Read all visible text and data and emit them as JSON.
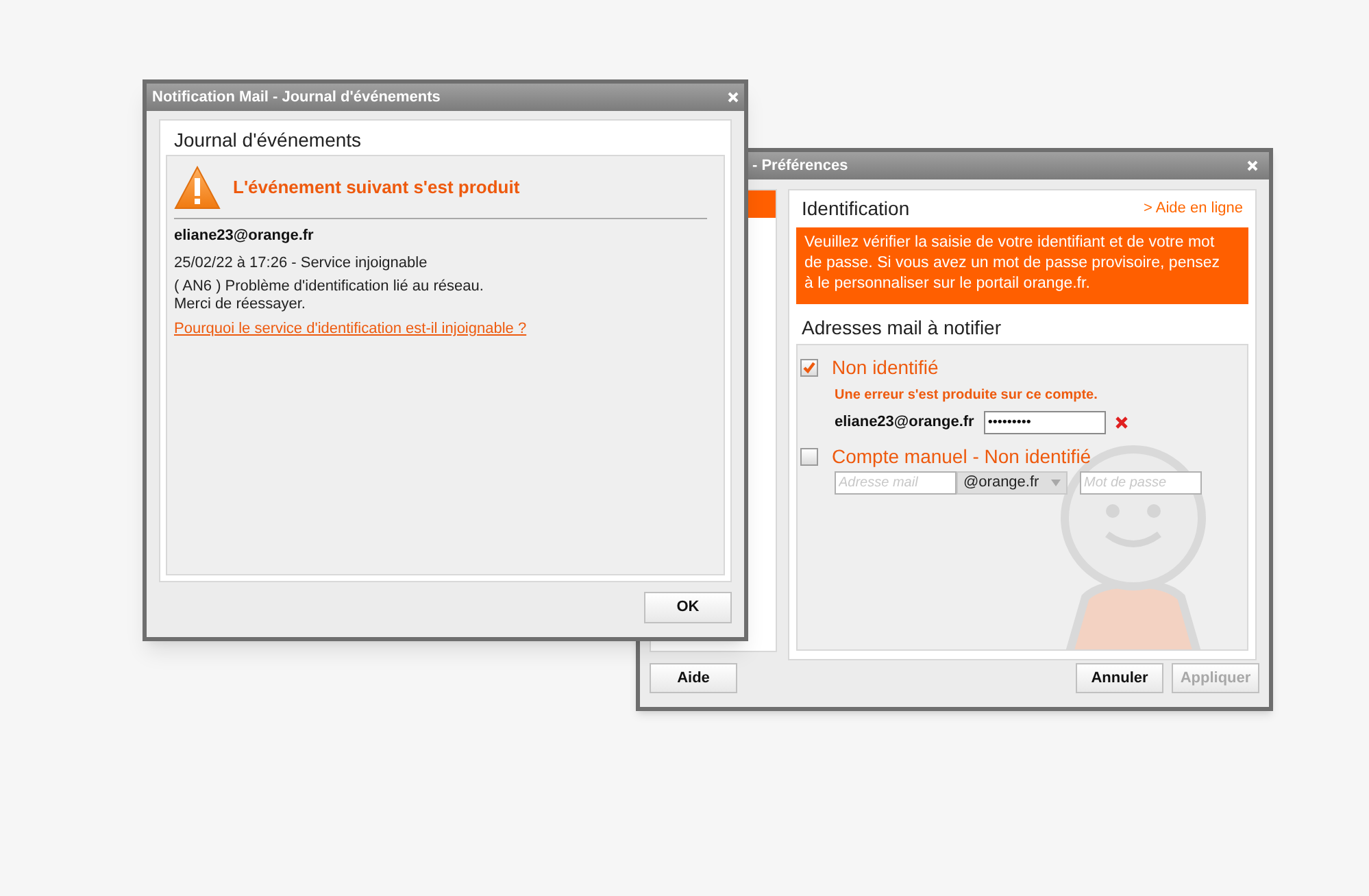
{
  "preferences_window": {
    "title": "- Préférences",
    "sidebar": {
      "items": [
        {
          "selected": true
        }
      ]
    },
    "section_title": "Identification",
    "help_link": "> Aide en ligne",
    "alert": "Veuillez vérifier la saisie de votre identifiant et de votre mot de passe. Si vous avez un mot de passe provisoire, pensez à le personnaliser sur le portail orange.fr.",
    "accounts_title": "Adresses mail à notifier",
    "accounts": [
      {
        "kind": "identified",
        "checked": true,
        "label": "Non identifié",
        "error": "Une erreur s'est produite sur ce compte.",
        "email": "eliane23@orange.fr",
        "password": "•••••••••"
      },
      {
        "kind": "manual",
        "checked": false,
        "label": "Compte manuel - Non identifié",
        "email_placeholder": "Adresse mail",
        "domain": "@orange.fr",
        "password_placeholder": "Mot de passe"
      }
    ],
    "buttons": [
      {
        "label": "Aide",
        "disabled": false
      },
      {
        "label": "Annuler",
        "disabled": false
      },
      {
        "label": "Appliquer",
        "disabled": true
      }
    ]
  },
  "journal_window": {
    "title": "Notification Mail - Journal d'événements",
    "heading": "Journal d'événements",
    "event_title": "L'événement suivant s'est produit",
    "email": "eliane23@orange.fr",
    "date_line": "25/02/22 à 17:26 - Service injoignable",
    "message_lines": [
      "( AN6 ) Problème d'identification lié au réseau.",
      "Merci de réessayer."
    ],
    "link": "Pourquoi le service d'identification est-il injoignable ?",
    "ok_button": "OK"
  }
}
